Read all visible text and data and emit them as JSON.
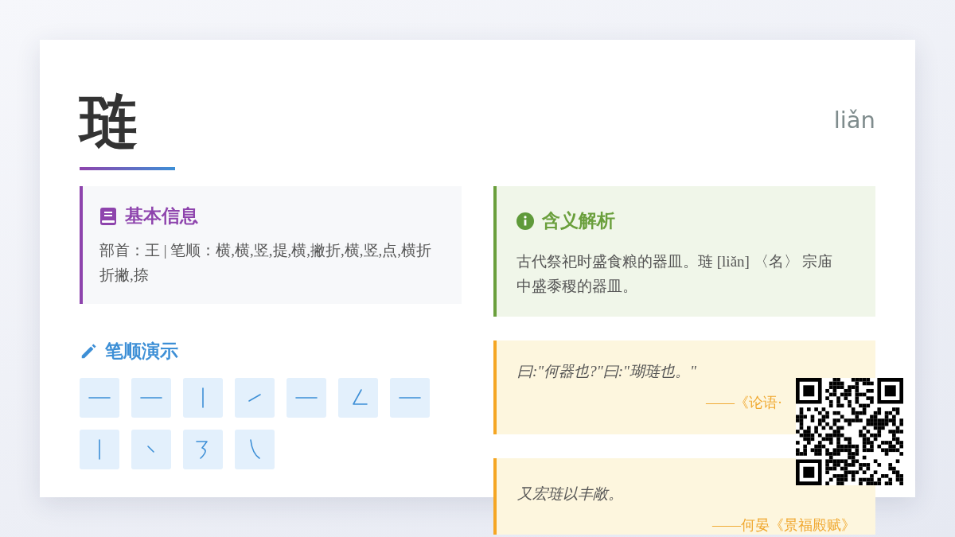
{
  "header": {
    "character": "琏",
    "pinyin": "liǎn"
  },
  "basic_info": {
    "title": "基本信息",
    "text": "部首：王 | 笔顺：横,横,竖,提,横,撇折,横,竖,点,横折折撇,捺"
  },
  "meaning": {
    "title": "含义解析",
    "text": "古代祭祀时盛食粮的器皿。琏 [liǎn] 〈名〉 宗庙中盛黍稷的器皿。"
  },
  "stroke_demo": {
    "title": "笔顺演示",
    "strokes": [
      {
        "kind": "heng"
      },
      {
        "kind": "heng"
      },
      {
        "kind": "shu"
      },
      {
        "kind": "ti"
      },
      {
        "kind": "heng"
      },
      {
        "kind": "piezhe"
      },
      {
        "kind": "heng"
      },
      {
        "kind": "shu"
      },
      {
        "kind": "dian"
      },
      {
        "kind": "hengzhezhepie"
      },
      {
        "kind": "na"
      }
    ]
  },
  "quotes": [
    {
      "text": "曰:\"何器也?\"曰:\"瑚琏也。\"",
      "source": "——《论语·"
    },
    {
      "text": "又宏琏以丰敞。",
      "source": "——何晏《景福殿赋》"
    }
  ]
}
